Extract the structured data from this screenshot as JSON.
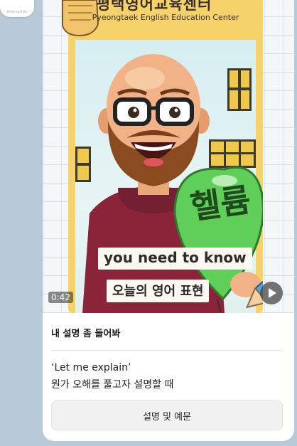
{
  "sender": {
    "avatar_text": "평택영어교육센터"
  },
  "video": {
    "header_korean": "평택영어교육센터",
    "header_english": "Pyeongtaek English Education Center",
    "balloon_text": "헬륨",
    "caption_english": "you need to know",
    "caption_korean": "오늘의 영어 표현",
    "duration": "0:42",
    "play_icon": "play-icon"
  },
  "message": {
    "title": "내 설명 좀 들어봐",
    "line1": "‘Let me explain’",
    "line2": "뭔가 오해를 풀고자 설명할 때"
  },
  "button": {
    "label": "설명 및 예문"
  },
  "colors": {
    "chat_background": "#b8c9d8",
    "frame_yellow": "#f6d26a",
    "balloon_green": "#5fcf5a"
  }
}
